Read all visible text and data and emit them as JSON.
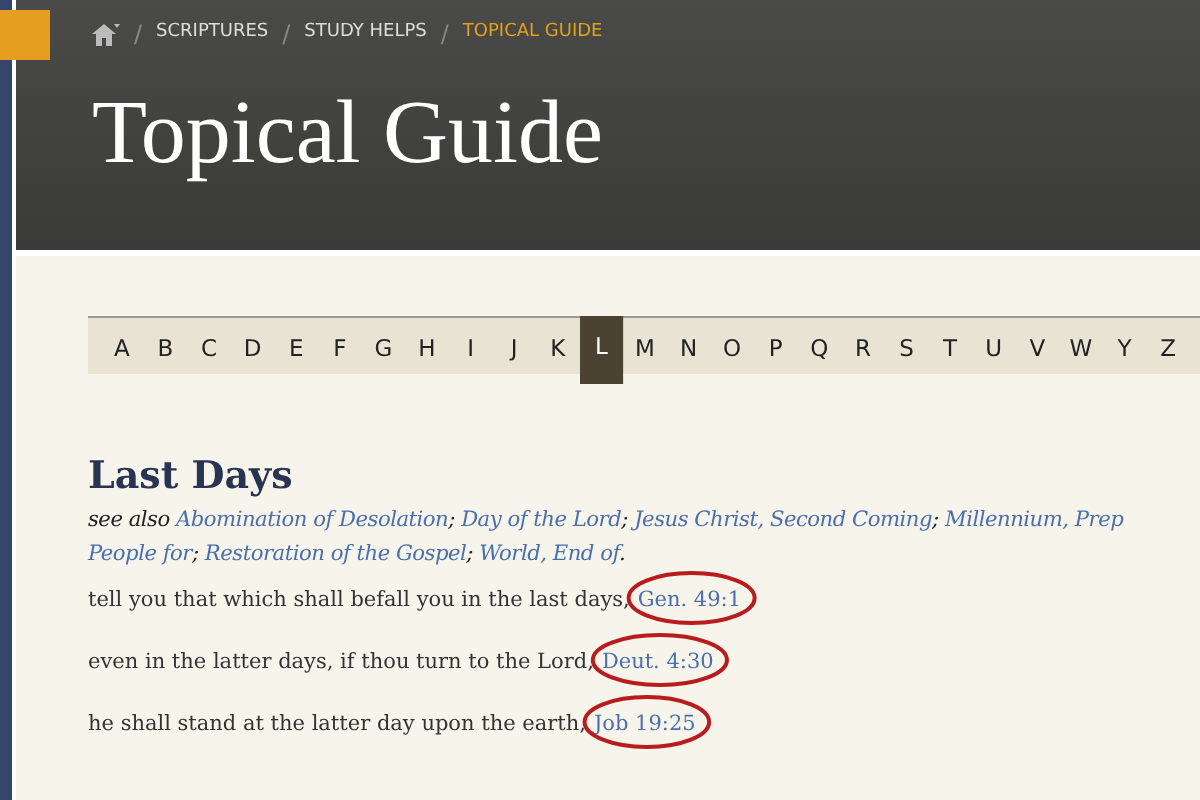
{
  "breadcrumb": [
    {
      "label": "SCRIPTURES",
      "current": false
    },
    {
      "label": "STUDY HELPS",
      "current": false
    },
    {
      "label": "TOPICAL GUIDE",
      "current": true
    }
  ],
  "breadcrumb_separator": "/",
  "title": "Topical Guide",
  "alphabet": [
    {
      "letter": "A",
      "selected": false
    },
    {
      "letter": "B",
      "selected": false
    },
    {
      "letter": "C",
      "selected": false
    },
    {
      "letter": "D",
      "selected": false
    },
    {
      "letter": "E",
      "selected": false
    },
    {
      "letter": "F",
      "selected": false
    },
    {
      "letter": "G",
      "selected": false
    },
    {
      "letter": "H",
      "selected": false
    },
    {
      "letter": "I",
      "selected": false
    },
    {
      "letter": "J",
      "selected": false
    },
    {
      "letter": "K",
      "selected": false
    },
    {
      "letter": "L",
      "selected": true
    },
    {
      "letter": "M",
      "selected": false
    },
    {
      "letter": "N",
      "selected": false
    },
    {
      "letter": "O",
      "selected": false
    },
    {
      "letter": "P",
      "selected": false
    },
    {
      "letter": "Q",
      "selected": false
    },
    {
      "letter": "R",
      "selected": false
    },
    {
      "letter": "S",
      "selected": false
    },
    {
      "letter": "T",
      "selected": false
    },
    {
      "letter": "U",
      "selected": false
    },
    {
      "letter": "V",
      "selected": false
    },
    {
      "letter": "W",
      "selected": false
    },
    {
      "letter": "Y",
      "selected": false
    },
    {
      "letter": "Z",
      "selected": false
    }
  ],
  "topic": {
    "heading": "Last Days",
    "see_also_label": "see also",
    "see_also_lines": [
      [
        {
          "text": "Abomination of Desolation",
          "after": ";"
        },
        {
          "text": "Day of the Lord",
          "after": ";"
        },
        {
          "text": "Jesus Christ, Second Coming",
          "after": ";"
        },
        {
          "text": "Millennium, Prep"
        }
      ],
      [
        {
          "text": "People for",
          "after": ";"
        },
        {
          "text": "Restoration of the Gospel",
          "after": ";"
        },
        {
          "text": "World, End of",
          "after": "."
        }
      ]
    ],
    "entries": [
      {
        "text": "tell you that which shall befall you in the last days,",
        "reference": "Gen. 49:1",
        "circled": true
      },
      {
        "text": "even in the latter days, if thou turn to the Lord,",
        "reference": "Deut. 4:30",
        "circled": true
      },
      {
        "text": "he shall stand at the latter day upon the earth,",
        "reference": "Job 19:25",
        "circled": true
      }
    ]
  }
}
